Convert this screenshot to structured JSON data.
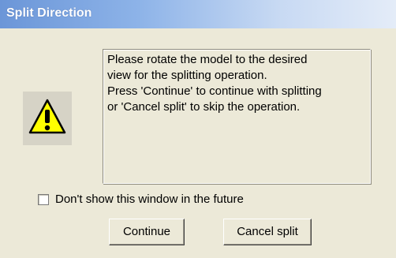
{
  "window": {
    "title": "Split Direction"
  },
  "message": {
    "lines": [
      "Please rotate the model to the desired",
      "view for the splitting operation.",
      "Press 'Continue' to continue with splitting",
      "or 'Cancel split' to skip the operation."
    ]
  },
  "icon": {
    "name": "warning-icon",
    "fill": "#ffff00",
    "stroke": "#000000"
  },
  "options": {
    "dont_show_label": "Don't show this window in the future",
    "dont_show_checked": false
  },
  "buttons": {
    "continue_label": "Continue",
    "cancel_label": "Cancel split"
  },
  "colors": {
    "dialog_bg": "#ece9d8",
    "title_gradient_start": "#6b96d8",
    "title_gradient_end": "#e4ecf8"
  }
}
